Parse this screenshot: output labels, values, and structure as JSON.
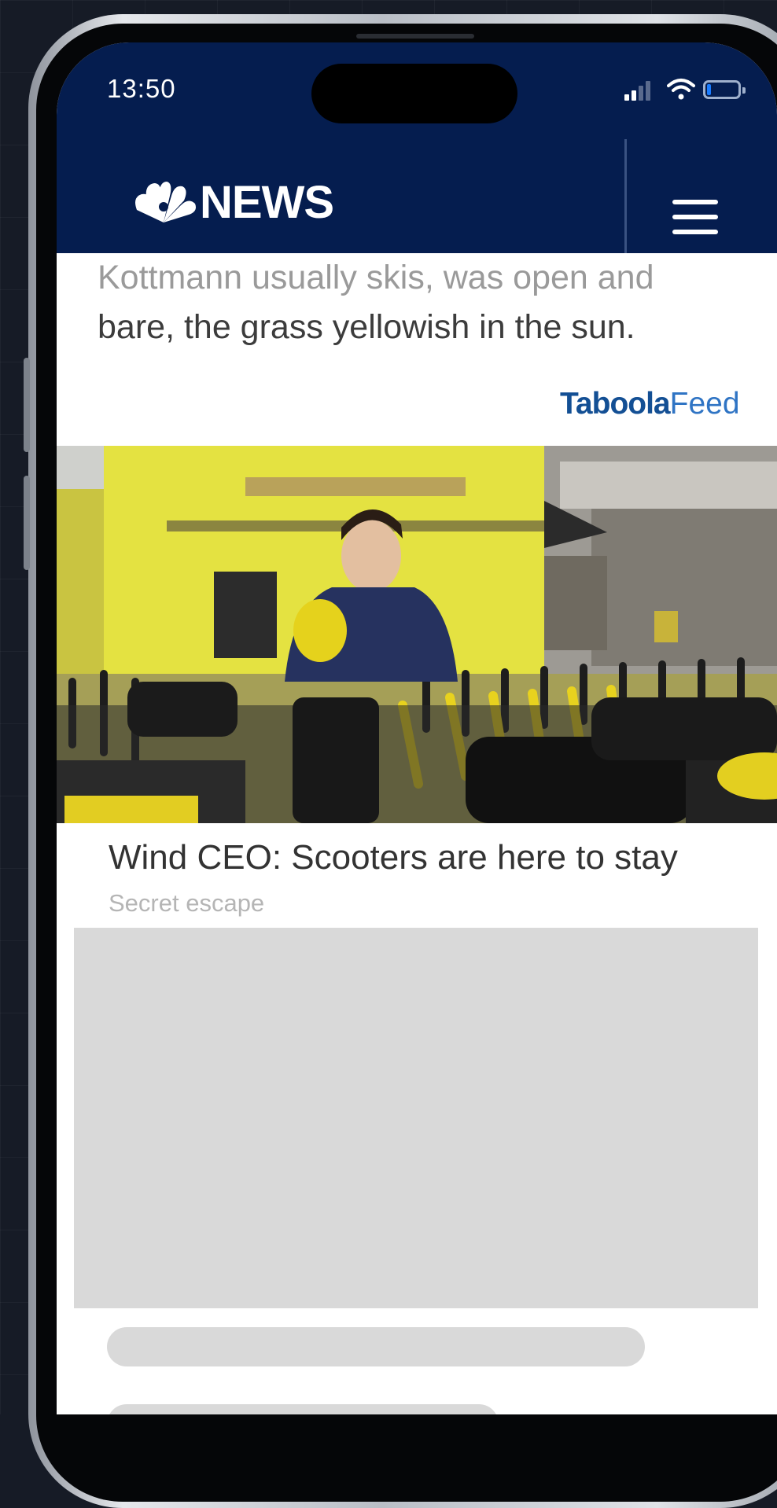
{
  "status_bar": {
    "time": "13:50",
    "icons": [
      "cellular-signal-icon",
      "wifi-icon",
      "battery-icon"
    ]
  },
  "header": {
    "logo_text": "NEWS",
    "logo_icon": "peacock-icon",
    "menu_icon": "hamburger-menu-icon",
    "background_color": "#051d4f"
  },
  "article": {
    "text_lines": [
      "Kottmann usually skis, was open and",
      "bare, the grass yellowish in the sun."
    ]
  },
  "feed": {
    "brand": "Taboola",
    "label": "Feed",
    "cards": [
      {
        "headline": "Wind CEO: Scooters are here to stay",
        "source": "Secret escape"
      }
    ]
  },
  "colors": {
    "taboola_brand": "#134f94",
    "taboola_feed": "#2f74c4",
    "placeholder": "#d9d9d9"
  }
}
